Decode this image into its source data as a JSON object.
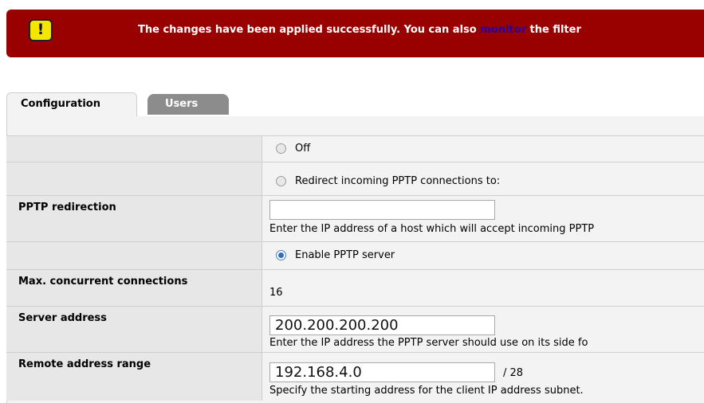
{
  "banner": {
    "text_before": "The changes have been applied successfully. You can also ",
    "link": "monitor",
    "text_after": " the filter",
    "icon": "warning-icon",
    "icon_glyph": "!",
    "color": "#990000"
  },
  "tabs": [
    {
      "label": "Configuration",
      "active": true
    },
    {
      "label": "Users",
      "active": false
    }
  ],
  "rows": {
    "off": {
      "label": "Off",
      "checked": false
    },
    "redirect": {
      "label": "Redirect incoming PPTP connections to:",
      "checked": false
    },
    "pptp_redirection": {
      "label": "PPTP redirection",
      "value": "",
      "hint": "Enter the IP address of a host which will accept incoming PPTP"
    },
    "enable": {
      "label": "Enable PPTP server",
      "checked": true
    },
    "max_connections": {
      "label": "Max. concurrent connections",
      "value": "16"
    },
    "server_address": {
      "label": "Server address",
      "value": "200.200.200.200",
      "hint": "Enter the IP address the PPTP server should use on its side fo"
    },
    "remote_range": {
      "label": "Remote address range",
      "value": "192.168.4.0",
      "suffix": "/ 28",
      "hint": "Specify the starting address for the client IP address subnet."
    }
  }
}
